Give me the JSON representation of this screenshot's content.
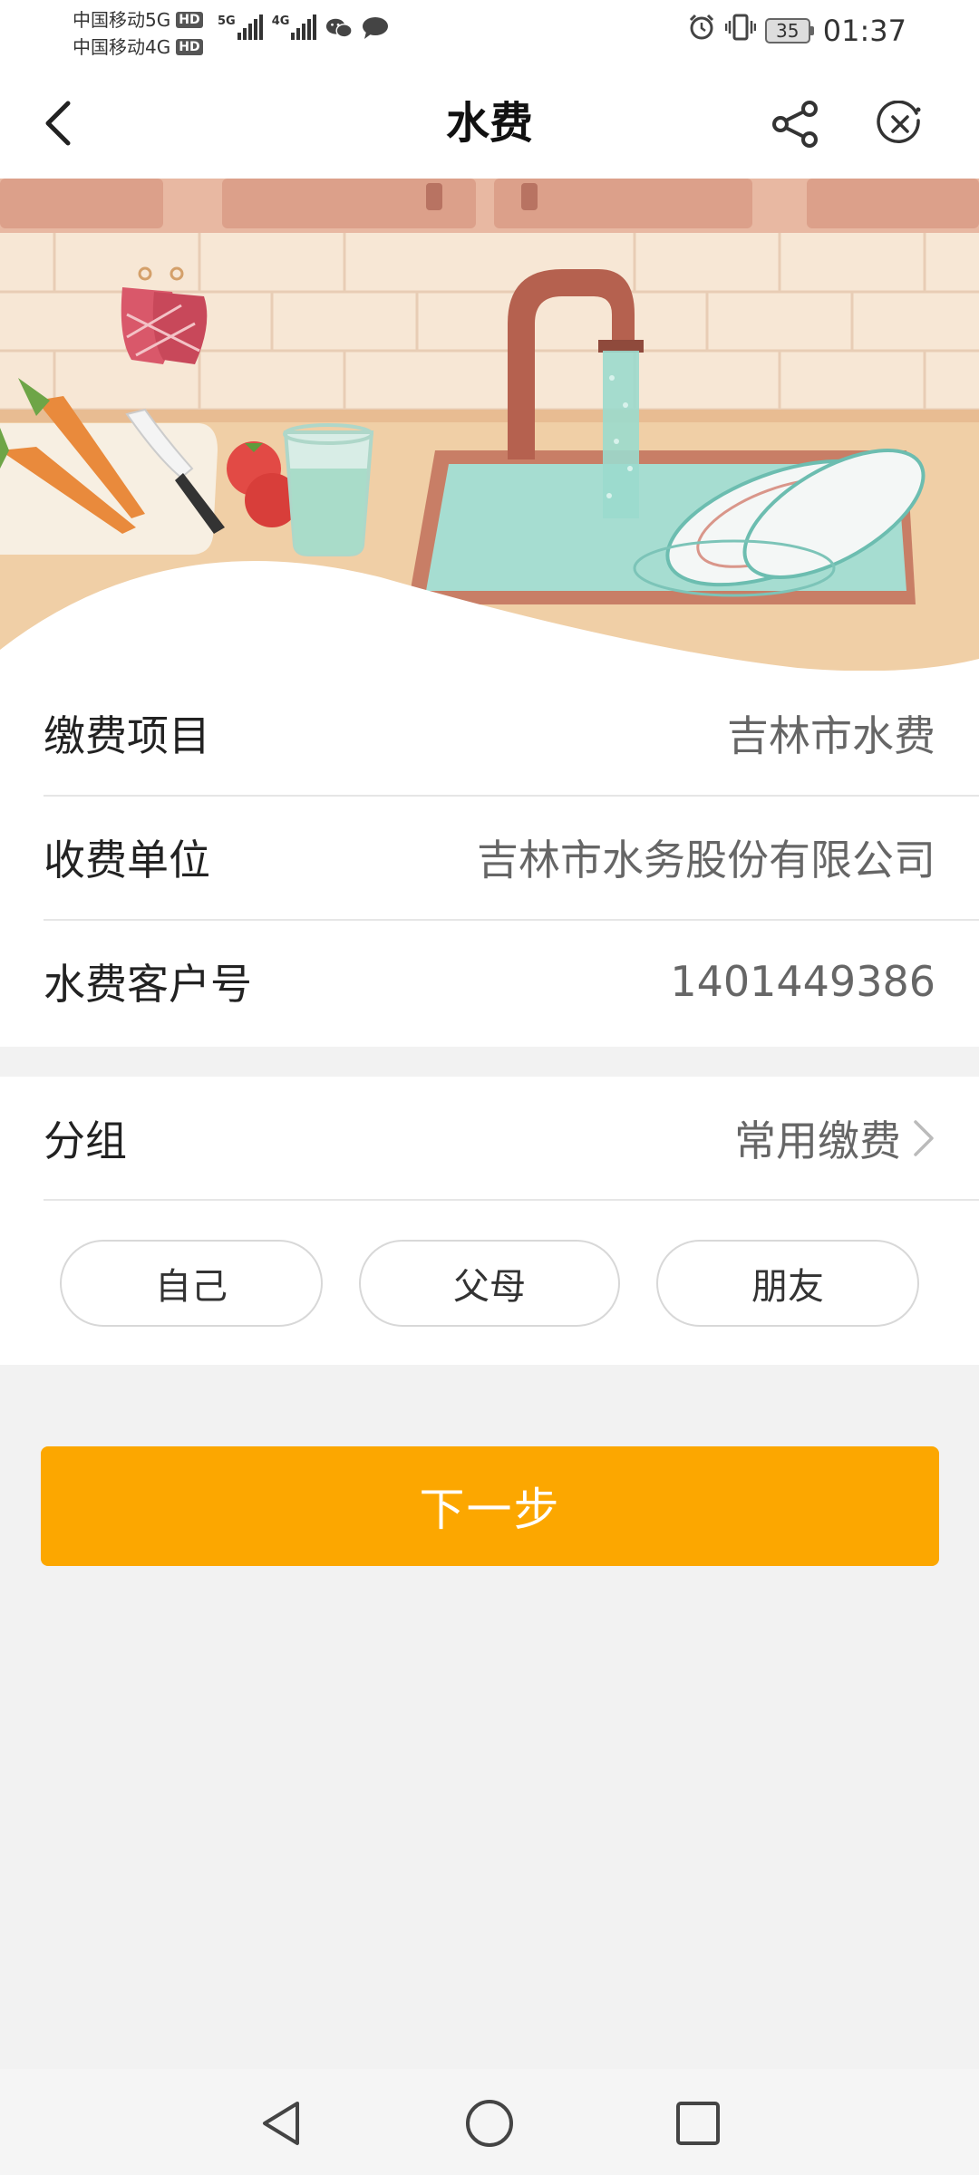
{
  "status_bar": {
    "carrier_1": "中国移动5G",
    "carrier_2": "中国移动4G",
    "hd_badge": "HD",
    "signal_1_tag": "5G",
    "signal_2_tag": "4G",
    "battery_level": "35",
    "time": "01:37"
  },
  "header": {
    "title": "水费",
    "back_icon": "chevron-left-icon",
    "share_icon": "share-icon",
    "close_icon": "close-circle-icon"
  },
  "info": {
    "rows": [
      {
        "label": "缴费项目",
        "value": "吉林市水费"
      },
      {
        "label": "收费单位",
        "value": "吉林市水务股份有限公司"
      },
      {
        "label": "水费客户号",
        "value": "1401449386"
      }
    ]
  },
  "group": {
    "label": "分组",
    "value": "常用缴费",
    "chips": [
      "自己",
      "父母",
      "朋友"
    ]
  },
  "actions": {
    "next_label": "下一步"
  },
  "colors": {
    "accent": "#fca700",
    "page_bg": "#f2f2f2"
  }
}
